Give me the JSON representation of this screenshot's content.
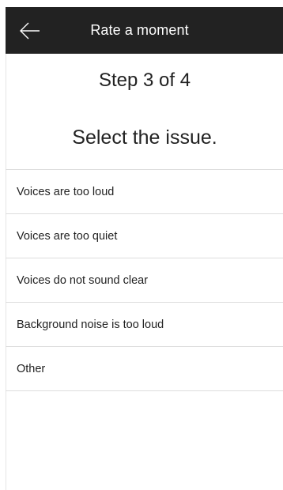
{
  "header": {
    "title": "Rate a moment",
    "back_icon": "arrow-left-icon"
  },
  "main": {
    "step": "Step 3 of 4",
    "prompt": "Select the issue.",
    "issues": [
      "Voices are too loud",
      "Voices are too quiet",
      "Voices do not sound clear",
      "Background noise is too loud",
      "Other"
    ]
  },
  "colors": {
    "app_bar": "#222222",
    "text": "#222222",
    "divider": "#dddddd"
  }
}
